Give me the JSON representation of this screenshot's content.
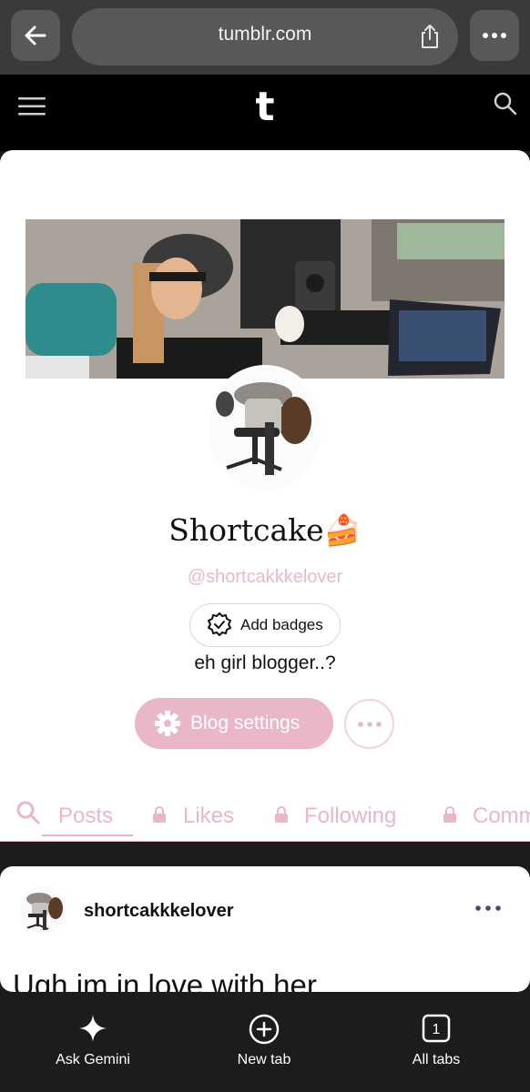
{
  "browser": {
    "url": "tumblr.com",
    "back_icon": "arrow-left-icon",
    "share_icon": "share-icon",
    "more_icon": "more-horizontal-icon"
  },
  "tumblr_header": {
    "logo": "t",
    "menu_icon": "hamburger-menu-icon",
    "search_icon": "search-icon"
  },
  "profile": {
    "title": "Shortcake🍰",
    "handle": "@shortcakkkelover",
    "badges_label": "Add badges",
    "bio": "eh girl blogger..?",
    "settings_label": "Blog settings"
  },
  "tabs": [
    {
      "label": "Posts",
      "locked": false,
      "active": true
    },
    {
      "label": "Likes",
      "locked": true,
      "active": false
    },
    {
      "label": "Following",
      "locked": true,
      "active": false
    },
    {
      "label": "Comm",
      "locked": true,
      "active": false
    }
  ],
  "post": {
    "username": "shortcakkkelover",
    "text": "Ugh im in love with her"
  },
  "bottom_bar": {
    "items": [
      {
        "label": "Ask Gemini",
        "icon": "sparkle-icon"
      },
      {
        "label": "New tab",
        "icon": "plus-circle-icon"
      },
      {
        "label": "All tabs",
        "icon": "tabs-count-icon",
        "count": "1"
      }
    ]
  },
  "colors": {
    "accent_pink": "#eab6ca",
    "handle_pink": "#e9b8cd",
    "browser_bar": "#3a3a3c",
    "header_black": "#000000"
  }
}
